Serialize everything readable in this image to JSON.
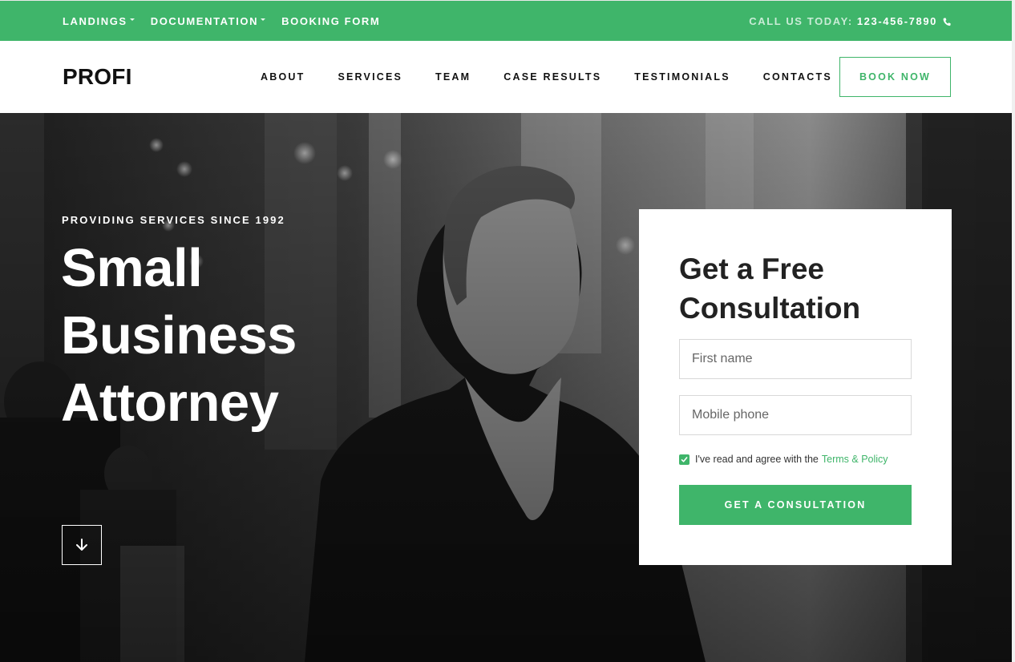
{
  "colors": {
    "accent": "#3fb56a",
    "text_dark": "#111111"
  },
  "topbar": {
    "links": [
      {
        "label": "LANDINGS",
        "has_dropdown": true
      },
      {
        "label": "DOCUMENTATION",
        "has_dropdown": true
      },
      {
        "label": "BOOKING FORM",
        "has_dropdown": false
      }
    ],
    "call_label": "CALL US TODAY:",
    "call_number": "123-456-7890",
    "phone_icon": "phone-icon"
  },
  "header": {
    "logo": "PROFI",
    "nav": [
      "ABOUT",
      "SERVICES",
      "TEAM",
      "CASE RESULTS",
      "TESTIMONIALS",
      "CONTACTS"
    ],
    "book_button": "BOOK NOW"
  },
  "hero": {
    "tagline": "PROVIDING SERVICES SINCE 1992",
    "headline_lines": [
      "Small",
      "Business",
      "Attorney"
    ],
    "scroll_icon": "arrow-down-icon",
    "image": "black-and-white photo of man in coat and scarf on city street"
  },
  "form": {
    "title_lines": [
      "Get a Free",
      "Consultation"
    ],
    "first_name_placeholder": "First name",
    "phone_placeholder": "Mobile phone",
    "agree_text": "I've read and agree with the",
    "terms_link": "Terms & Policy",
    "checkbox_checked": true,
    "submit_label": "GET A CONSULTATION"
  }
}
